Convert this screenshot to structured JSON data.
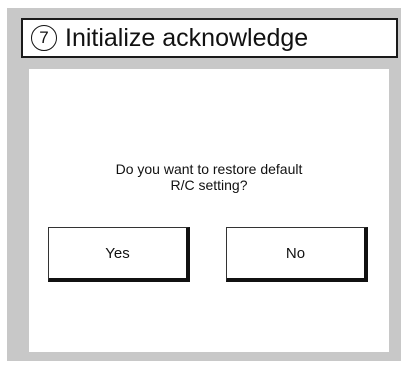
{
  "screen": {
    "title_number": "7",
    "title": "Initialize acknowledge"
  },
  "dialog": {
    "message_line1": "Do you want to restore default",
    "message_line2": "R/C setting?",
    "yes_label": "Yes",
    "no_label": "No"
  },
  "colors": {
    "frame": "#c8c8c8",
    "panel": "#ffffff",
    "text": "#111111"
  }
}
